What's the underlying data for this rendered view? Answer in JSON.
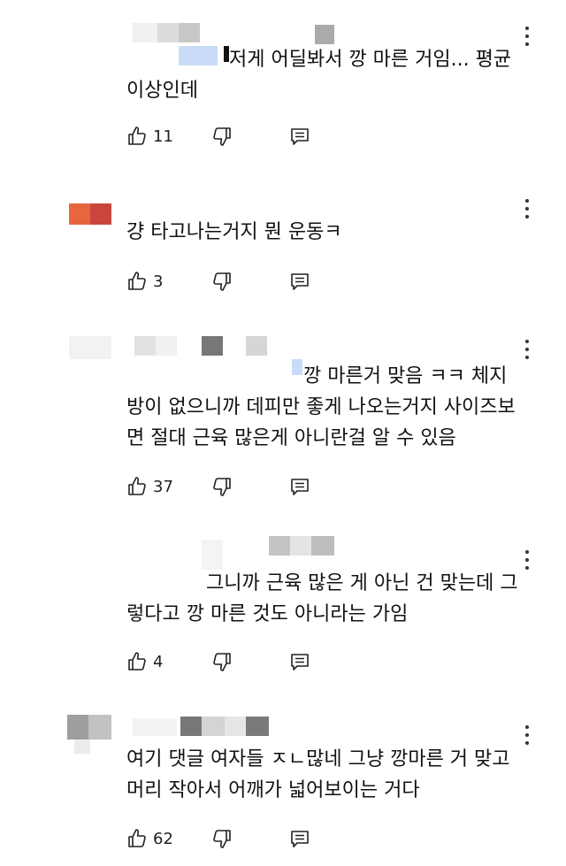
{
  "comments": [
    {
      "text": "저게 어딜봐서 깡 마른 거임... 평균 이상인데",
      "likes": "11"
    },
    {
      "text": "걍 타고나는거지 뭔 운동ㅋ",
      "likes": "3"
    },
    {
      "text": "깡 마른거 맞음 ㅋㅋ 체지방이 없으니까 데피만 좋게 나오는거지 사이즈보면 절대 근육 많은게 아니란걸 알 수 있음",
      "likes": "37"
    },
    {
      "text": "그니까 근육 많은 게 아닌 건 맞는데 그렇다고 깡 마른 것도 아니라는 가임",
      "likes": "4"
    },
    {
      "text": "여기 댓글 여자들 ㅈㄴ많네 그냥 깡마른 거 맞고 머리 작아서 어깨가 넓어보이는 거다",
      "likes": "62"
    }
  ],
  "icons": {
    "like": "thumbs-up-icon",
    "dislike": "thumbs-down-icon",
    "reply": "reply-icon",
    "more": "more-vertical-icon"
  },
  "colors": {
    "redacted_avatar_primary": "#e8663d",
    "redacted_avatar_secondary": "#c9463c",
    "redacted_gray": "#bdbdbd",
    "redacted_blue": "#c9dcf7"
  }
}
